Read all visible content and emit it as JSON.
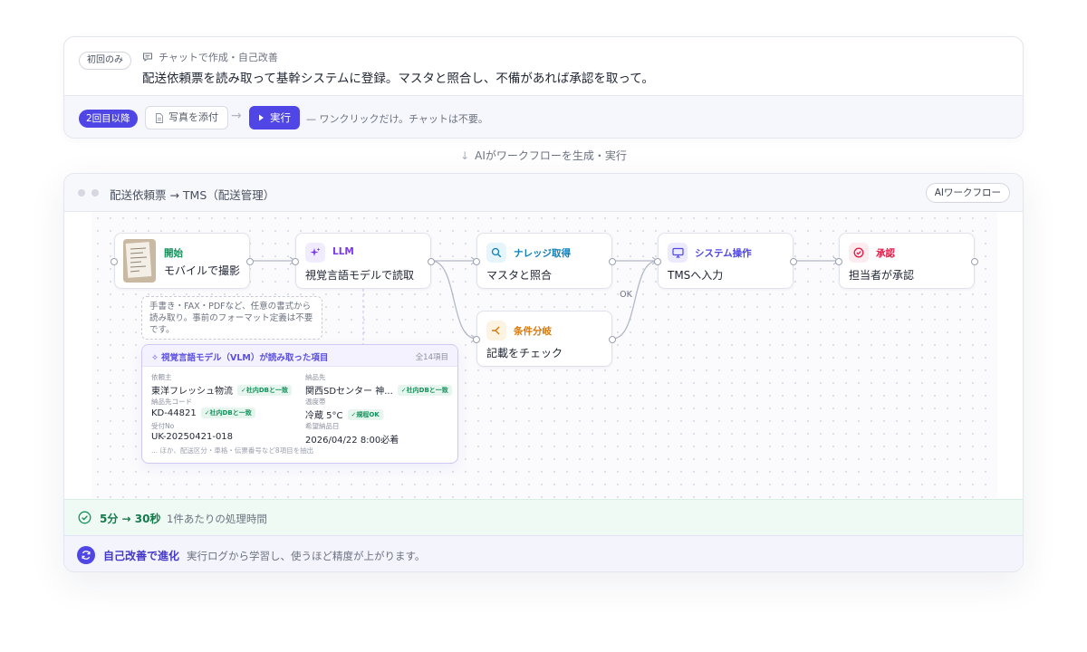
{
  "top": {
    "first_pill": "初回のみ",
    "chat_meta": "チャットで作成・自己改善",
    "chat_main": "配送依頼票を読み取って基幹システムに登録。マスタと照合し、不備があれば承認を取って。",
    "second_pill": "2回目以降",
    "attach_label": "写真を添付",
    "run_label": "実行",
    "run_note": "— ワンクリックだけ。チャットは不要。"
  },
  "generate_label": "AIがワークフローを生成・実行",
  "workflow": {
    "title": "配送依頼票 → TMS（配送管理）",
    "badge": "AIワークフロー",
    "nodes": [
      {
        "type": "開始",
        "text": "モバイルで撮影",
        "color": "#12915b"
      },
      {
        "type": "LLM",
        "text": "視覚言語モデルで読取",
        "color": "#7c3aed"
      },
      {
        "type": "ナレッジ取得",
        "text": "マスタと照合",
        "color": "#0e7fb8"
      },
      {
        "type": "条件分岐",
        "text": "記載をチェック",
        "color": "#d97706"
      },
      {
        "type": "システム操作",
        "text": "TMSへ入力",
        "color": "#4f46e5"
      },
      {
        "type": "承認",
        "text": "担当者が承認",
        "color": "#e11d48"
      }
    ],
    "edge_label_ok": "OK",
    "start_desc": "手書き・FAX・PDFなど、任意の書式から読み取り。事前のフォーマット定義は不要です。",
    "vlm": {
      "title": "視覚言語モデル（VLM）が読み取った項目",
      "count": "全14項目",
      "fields": [
        {
          "label": "依頼主",
          "value": "東洋フレッシュ物流",
          "tag": "✓社内DBと一致"
        },
        {
          "label": "納品先",
          "value": "関西SDセンター 神...",
          "tag": "✓社内DBと一致"
        },
        {
          "label": "納品先コード",
          "value": "KD-44821",
          "tag": "✓社内DBと一致"
        },
        {
          "label": "温度帯",
          "value": "冷蔵 5°C",
          "tag": "✓規程OK"
        },
        {
          "label": "受付No",
          "value": "UK-20250421-018",
          "tag": ""
        },
        {
          "label": "希望納品日",
          "value": "2026/04/22 8:00必着",
          "tag": ""
        }
      ],
      "footer": "... ほか、配送区分・車格・伝票番号など8項目を抽出"
    }
  },
  "time": {
    "bold": "5分 → 30秒",
    "note": "1件あたりの処理時間"
  },
  "evolve": {
    "bold": "自己改善で進化",
    "note": "実行ログから学習し、使うほど精度が上がります。"
  }
}
